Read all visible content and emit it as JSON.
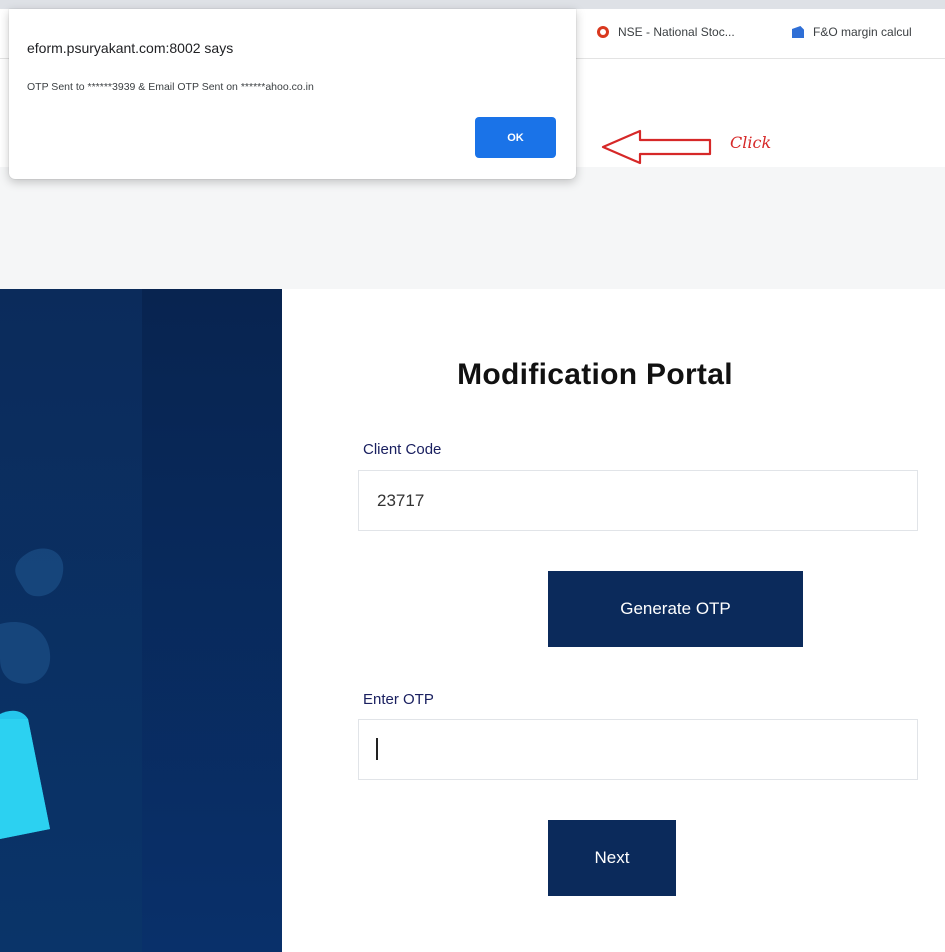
{
  "bookmarks": [
    {
      "label": "NSE - National Stoc...",
      "icon": "nse-icon"
    },
    {
      "label": "F&O margin calcul",
      "icon": "document-icon"
    }
  ],
  "alert": {
    "title": "eform.psuryakant.com:8002 says",
    "message": "OTP Sent to ******3939 & Email OTP Sent on ******ahoo.co.in",
    "ok_label": "OK"
  },
  "annotation": {
    "note": "Click",
    "color": "#d62828"
  },
  "form": {
    "title": "Modification Portal",
    "client_code_label": "Client Code",
    "client_code_value": "23717",
    "generate_otp_label": "Generate OTP",
    "otp_label": "Enter OTP",
    "otp_value": "",
    "next_label": "Next"
  },
  "colors": {
    "brand_navy": "#0b2a5b",
    "dialog_button": "#1a73e8",
    "label_text": "#1a2060"
  }
}
